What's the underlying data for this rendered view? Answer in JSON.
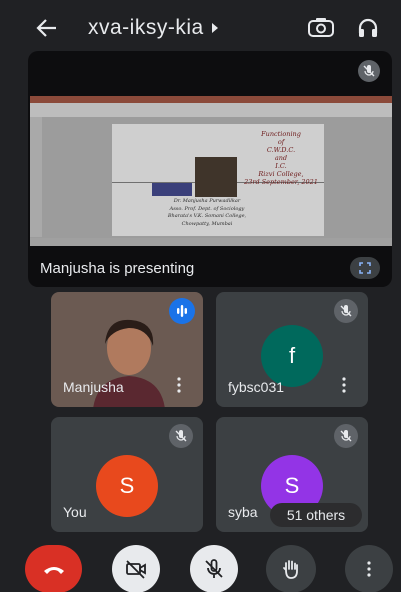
{
  "header": {
    "meeting_code": "xva-iksy-kia"
  },
  "presentation": {
    "label": "Manjusha is presenting",
    "slide_title_lines": [
      "Functioning",
      "of",
      "C.W.D.C.",
      "and",
      "I.C.",
      "Rizvi College,",
      "23rd September, 2021"
    ],
    "slide_sub_lines": [
      "Dr. Manjusha Purwadilkar",
      "Asso. Prof. Dept. of Sociology",
      "Bharata's V.K. Somani College,",
      "Chowpatty, Mumbai"
    ]
  },
  "participants": [
    {
      "name": "Manjusha",
      "speaking": true
    },
    {
      "name": "fybsc031",
      "initial": "f",
      "muted": true,
      "avatar_color": "#00695c"
    },
    {
      "name": "You",
      "initial": "S",
      "muted": true,
      "avatar_color": "#e8491d"
    },
    {
      "name": "syba",
      "initial": "S",
      "muted": true,
      "avatar_color": "#9334e6"
    }
  ],
  "others_label": "51 others",
  "controls": {
    "end_call": "end-call-icon",
    "camera": "camera-off-icon",
    "mic": "mic-off-icon",
    "hand": "raise-hand-icon",
    "more": "more-options-icon"
  },
  "colors": {
    "end_call": "#d93025",
    "speaking_indicator": "#1a73e8"
  }
}
